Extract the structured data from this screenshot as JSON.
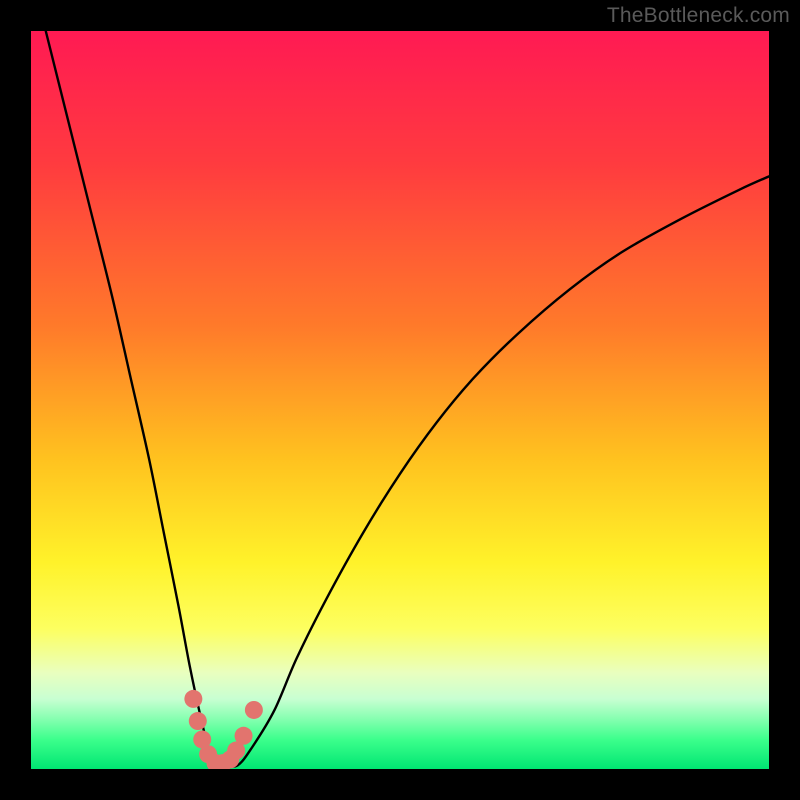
{
  "watermark": "TheBottleneck.com",
  "chart_data": {
    "type": "line",
    "title": "",
    "xlabel": "",
    "ylabel": "",
    "xlim": [
      0,
      100
    ],
    "ylim": [
      0,
      100
    ],
    "gradient_stops": [
      {
        "offset": 0,
        "color": "#ff1a53"
      },
      {
        "offset": 0.18,
        "color": "#ff3b3f"
      },
      {
        "offset": 0.4,
        "color": "#ff7a2a"
      },
      {
        "offset": 0.58,
        "color": "#ffc21f"
      },
      {
        "offset": 0.72,
        "color": "#fff22a"
      },
      {
        "offset": 0.81,
        "color": "#fdff60"
      },
      {
        "offset": 0.87,
        "color": "#e9ffbf"
      },
      {
        "offset": 0.905,
        "color": "#c8ffd2"
      },
      {
        "offset": 0.93,
        "color": "#8bffb3"
      },
      {
        "offset": 0.96,
        "color": "#3cff8c"
      },
      {
        "offset": 1.0,
        "color": "#00e672"
      }
    ],
    "series": [
      {
        "name": "curve",
        "x": [
          2,
          5,
          8,
          11,
          13.5,
          16,
          18,
          20,
          21.5,
          23,
          24,
          25,
          26,
          28,
          30,
          33,
          36,
          40,
          45,
          50,
          55,
          60,
          66,
          73,
          80,
          88,
          96,
          100
        ],
        "y": [
          100,
          88,
          76,
          64,
          53,
          42,
          32,
          22,
          14,
          7,
          3,
          0.5,
          0.5,
          0.5,
          3,
          8,
          15,
          23,
          32,
          40,
          47,
          53,
          59,
          65,
          70,
          74.5,
          78.5,
          80.3
        ]
      }
    ],
    "markers": {
      "x": [
        22.0,
        22.6,
        23.2,
        24.0,
        25.0,
        26.0,
        27.0,
        27.8,
        28.8,
        30.2
      ],
      "y": [
        9.5,
        6.5,
        4.0,
        2.0,
        0.8,
        0.8,
        1.3,
        2.5,
        4.5,
        8.0
      ],
      "color": "#e2746e",
      "radius": 9
    }
  }
}
